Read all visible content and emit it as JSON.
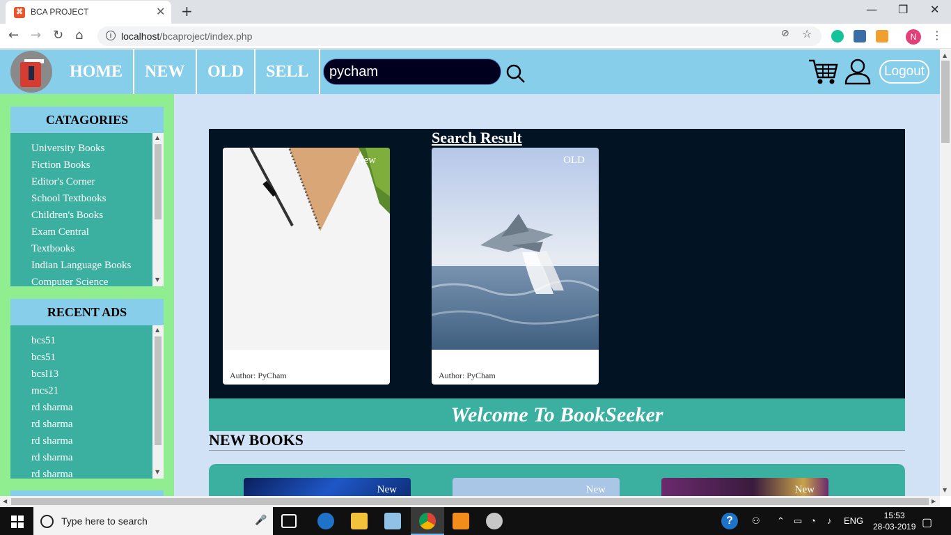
{
  "browser": {
    "tab_title": "BCA PROJECT",
    "url_host": "localhost",
    "url_path": "/bcaproject/index.php",
    "profile_initial": "N"
  },
  "header": {
    "nav": [
      "HOME",
      "NEW",
      "OLD",
      "SELL"
    ],
    "search_value": "pycham",
    "logout_label": "Logout"
  },
  "sidebar": {
    "categories_title": "CATAGORIES",
    "categories": [
      "University Books",
      "Fiction Books",
      "Editor's Corner",
      "School Textbooks",
      "Children's Books",
      "Exam Central",
      "Textbooks",
      "Indian Language Books",
      "Computer Science"
    ],
    "recent_title": "RECENT ADS",
    "recent": [
      "bcs51",
      "bcs51",
      "bcsl13",
      "mcs21",
      "rd sharma",
      "rd sharma",
      "rd sharma",
      "rd sharma",
      "rd sharma"
    ]
  },
  "results": {
    "title": "Search Result",
    "cards": [
      {
        "badge": "New",
        "author": "Author: PyCham"
      },
      {
        "badge": "OLD",
        "author": "Author: PyCham"
      }
    ]
  },
  "welcome": "Welcome To BookSeeker",
  "new_books": {
    "title": "NEW BOOKS",
    "badges": [
      "New",
      "New",
      "New"
    ]
  },
  "taskbar": {
    "search_placeholder": "Type here to search",
    "lang": "ENG",
    "time": "15:53",
    "date": "28-03-2019"
  }
}
